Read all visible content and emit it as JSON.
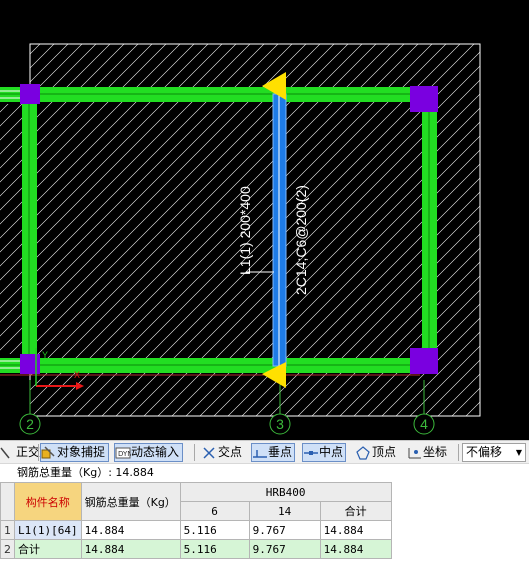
{
  "drawing": {
    "axis_labels": [
      "2",
      "3",
      "4"
    ],
    "beam_label": "L1(1) 200*400",
    "rebar_label": "2C14;C6@200(2)",
    "colors": {
      "beam_green": "#22dd22",
      "selected_beam": "#1e7be6",
      "column": "#7a00e0",
      "marker": "#ffe000",
      "hatch": "#ffffff",
      "axis": "#3cba3c"
    }
  },
  "toolbar": {
    "items": [
      {
        "label": "正交",
        "icon": "ortho-icon"
      },
      {
        "label": "对象捕捉",
        "icon": "snap-icon"
      },
      {
        "label": "动态输入",
        "icon": "dynamic-input-icon"
      },
      {
        "label": "交点",
        "icon": "intersection-icon"
      },
      {
        "label": "垂点",
        "icon": "perpendicular-icon"
      },
      {
        "label": "中点",
        "icon": "midpoint-icon"
      },
      {
        "label": "顶点",
        "icon": "vertex-icon"
      },
      {
        "label": "坐标",
        "icon": "coordinate-icon"
      }
    ],
    "offset_select": "不偏移"
  },
  "summary": {
    "text": "钢筋总重量（Kg）: 14.884"
  },
  "table": {
    "headers": {
      "name": "构件名称",
      "total": "钢筋总重量（Kg）",
      "group": "HRB400",
      "sub": [
        "6",
        "14",
        "合计"
      ]
    },
    "rows": [
      {
        "index": "1",
        "name": "L1(1)[64]",
        "total": "14.884",
        "d6": "5.116",
        "d14": "9.767",
        "sum": "14.884"
      },
      {
        "index": "2",
        "name": "合计",
        "total": "14.884",
        "d6": "5.116",
        "d14": "9.767",
        "sum": "14.884"
      }
    ]
  }
}
